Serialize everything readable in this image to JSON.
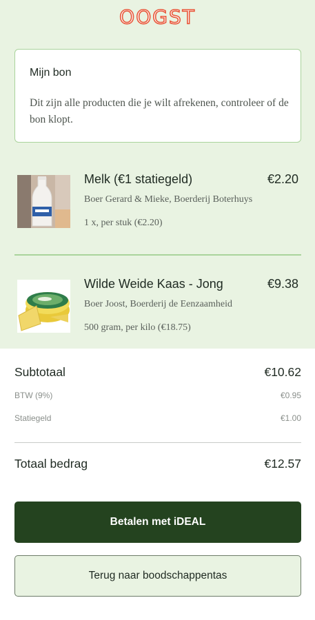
{
  "header": {
    "logo_text": "OOGST"
  },
  "receipt_info": {
    "title": "Mijn bon",
    "description": "Dit zijn alle producten die je wilt afrekenen, controleer of de bon klopt."
  },
  "products": [
    {
      "name": "Melk (€1 statiegeld)",
      "price": "€2.20",
      "farm": "Boer Gerard & Mieke, Boerderij Boterhuys",
      "quantity": "1 x, per stuk (€2.20)",
      "image_icon": "milk-bottle-image"
    },
    {
      "name": "Wilde Weide Kaas - Jong",
      "price": "€9.38",
      "farm": "Boer Joost, Boerderij de Eenzaamheid",
      "quantity": "500 gram, per kilo (€18.75)",
      "image_icon": "cheese-image"
    }
  ],
  "summary": {
    "subtotal_label": "Subtotaal",
    "subtotal_value": "€10.62",
    "btw_label": "BTW (9%)",
    "btw_value": "€0.95",
    "deposit_label": "Statiegeld",
    "deposit_value": "€1.00",
    "total_label": "Totaal bedrag",
    "total_value": "€12.57"
  },
  "actions": {
    "pay_label": "Betalen met iDEAL",
    "back_label": "Terug naar boodschappentas"
  },
  "colors": {
    "brand": "#e8583b",
    "background_green": "#e9f3e2",
    "card_border": "#a9d39b",
    "primary_button": "#24431f"
  }
}
